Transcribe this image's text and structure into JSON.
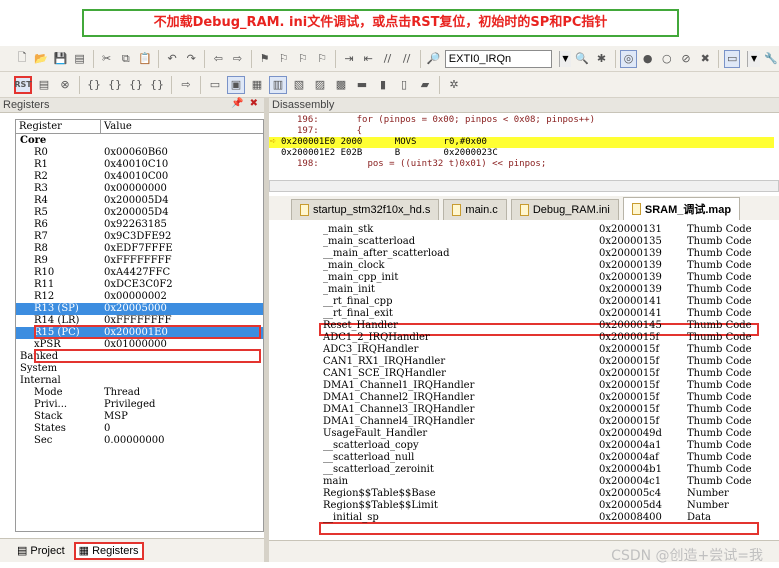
{
  "banner": {
    "text": "不加载Debug_RAM. ini文件调试，或点击RST复位，初始时的SP和PC指针"
  },
  "toolbar": {
    "target_combo": "EXTI0_IRQn",
    "rst_label": "RST"
  },
  "registers_panel": {
    "title": "Registers",
    "col_register": "Register",
    "col_value": "Value",
    "rows": [
      {
        "name": "Core",
        "value": ""
      },
      {
        "name": "R0",
        "value": "0x00060B60"
      },
      {
        "name": "R1",
        "value": "0x40010C10"
      },
      {
        "name": "R2",
        "value": "0x40010C00"
      },
      {
        "name": "R3",
        "value": "0x00000000"
      },
      {
        "name": "R4",
        "value": "0x200005D4"
      },
      {
        "name": "R5",
        "value": "0x200005D4"
      },
      {
        "name": "R6",
        "value": "0x92263185"
      },
      {
        "name": "R7",
        "value": "0x9C3DFE92"
      },
      {
        "name": "R8",
        "value": "0xEDF7FFFE"
      },
      {
        "name": "R9",
        "value": "0xFFFFFFFF"
      },
      {
        "name": "R10",
        "value": "0xA4427FFC"
      },
      {
        "name": "R11",
        "value": "0xDCE3C0F2"
      },
      {
        "name": "R12",
        "value": "0x00000002"
      },
      {
        "name": "R13 (SP)",
        "value": "0x20005000"
      },
      {
        "name": "R14 (LR)",
        "value": "0xFFFFFFFF"
      },
      {
        "name": "R15 (PC)",
        "value": "0x200001E0"
      },
      {
        "name": "xPSR",
        "value": "0x01000000"
      },
      {
        "name": "Banked",
        "value": ""
      },
      {
        "name": "System",
        "value": ""
      },
      {
        "name": "Internal",
        "value": ""
      },
      {
        "name": "Mode",
        "value": "Thread"
      },
      {
        "name": "Privi...",
        "value": "Privileged"
      },
      {
        "name": "Stack",
        "value": "MSP"
      },
      {
        "name": "States",
        "value": "0"
      },
      {
        "name": "Sec",
        "value": "0.00000000"
      }
    ]
  },
  "left_tabs": {
    "project": "Project",
    "registers": "Registers"
  },
  "disassembly": {
    "title": "Disassembly",
    "lines": [
      "196:       for (pinpos = 0x00; pinpos < 0x08; pinpos++)",
      "197:       {",
      "0x200001E0 2000      MOVS     r0,#0x00",
      "0x200001E2 E02B      B        0x2000023C",
      "198:         pos = ((uint32 t)0x01) << pinpos;"
    ]
  },
  "file_tabs": [
    "startup_stm32f10x_hd.s",
    "main.c",
    "Debug_RAM.ini",
    "SRAM_调试.map"
  ],
  "map_rows": [
    {
      "sym": "_main_stk",
      "addr": "0x20000131",
      "type": "Thumb Code"
    },
    {
      "sym": "_main_scatterload",
      "addr": "0x20000135",
      "type": "Thumb Code"
    },
    {
      "sym": "__main_after_scatterload",
      "addr": "0x20000139",
      "type": "Thumb Code"
    },
    {
      "sym": "_main_clock",
      "addr": "0x20000139",
      "type": "Thumb Code"
    },
    {
      "sym": "_main_cpp_init",
      "addr": "0x20000139",
      "type": "Thumb Code"
    },
    {
      "sym": "_main_init",
      "addr": "0x20000139",
      "type": "Thumb Code"
    },
    {
      "sym": "__rt_final_cpp",
      "addr": "0x20000141",
      "type": "Thumb Code"
    },
    {
      "sym": "__rt_final_exit",
      "addr": "0x20000141",
      "type": "Thumb Code"
    },
    {
      "sym": "Reset_Handler",
      "addr": "0x20000145",
      "type": "Thumb Code"
    },
    {
      "sym": "ADC1_2_IRQHandler",
      "addr": "0x2000015f",
      "type": "Thumb Code"
    },
    {
      "sym": "ADC3_IRQHandler",
      "addr": "0x2000015f",
      "type": "Thumb Code"
    },
    {
      "sym": "CAN1_RX1_IRQHandler",
      "addr": "0x2000015f",
      "type": "Thumb Code"
    },
    {
      "sym": "CAN1_SCE_IRQHandler",
      "addr": "0x2000015f",
      "type": "Thumb Code"
    },
    {
      "sym": "DMA1_Channel1_IRQHandler",
      "addr": "0x2000015f",
      "type": "Thumb Code"
    },
    {
      "sym": "DMA1_Channel2_IRQHandler",
      "addr": "0x2000015f",
      "type": "Thumb Code"
    },
    {
      "sym": "DMA1_Channel3_IRQHandler",
      "addr": "0x2000015f",
      "type": "Thumb Code"
    },
    {
      "sym": "DMA1_Channel4_IRQHandler",
      "addr": "0x2000015f",
      "type": "Thumb Code"
    },
    {
      "sym": "UsageFault_Handler",
      "addr": "0x2000049d",
      "type": "Thumb Code"
    },
    {
      "sym": "__scatterload_copy",
      "addr": "0x200004a1",
      "type": "Thumb Code"
    },
    {
      "sym": "__scatterload_null",
      "addr": "0x200004af",
      "type": "Thumb Code"
    },
    {
      "sym": "__scatterload_zeroinit",
      "addr": "0x200004b1",
      "type": "Thumb Code"
    },
    {
      "sym": "main",
      "addr": "0x200004c1",
      "type": "Thumb Code"
    },
    {
      "sym": "Region$$Table$$Base",
      "addr": "0x200005c4",
      "type": "Number"
    },
    {
      "sym": "Region$$Table$$Limit",
      "addr": "0x200005d4",
      "type": "Number"
    },
    {
      "sym": "__initial_sp",
      "addr": "0x20008400",
      "type": "Data"
    }
  ],
  "watermark": "CSDN @创造+尝试=我"
}
